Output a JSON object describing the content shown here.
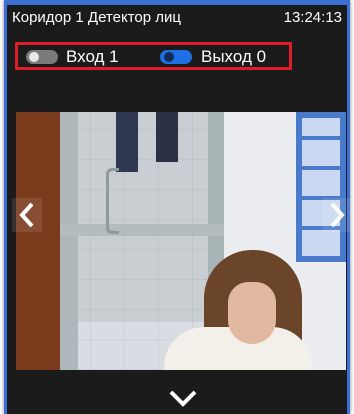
{
  "window": {
    "title": "Коридор 1 Детектор лиц",
    "time": "13:24:13"
  },
  "toggles": [
    {
      "label": "Вход 1",
      "state": "off"
    },
    {
      "label": "Выход 0",
      "state": "on"
    }
  ],
  "colors": {
    "accent": "#3b6fd6",
    "highlight_border": "#e01e2a",
    "toggle_on": "#1f6fe5",
    "toggle_off": "#7a7a7a",
    "background": "#1b1b1b"
  },
  "icons": {
    "prev": "chevron-left-icon",
    "next": "chevron-right-icon",
    "down": "chevron-down-icon"
  }
}
